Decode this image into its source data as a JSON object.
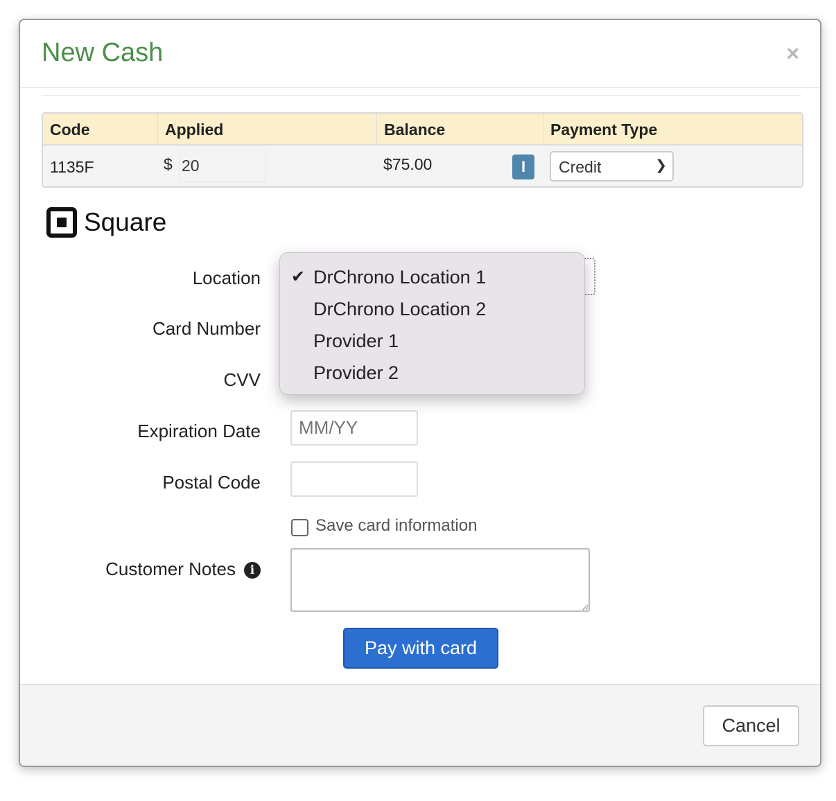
{
  "modal": {
    "title": "New Cash",
    "close_label": "×"
  },
  "table": {
    "headers": [
      "Code",
      "Applied",
      "Balance",
      "Payment Type"
    ],
    "row": {
      "code": "1135F",
      "currency": "$",
      "applied": "20",
      "balance": "$75.00",
      "info_button": "I",
      "payment_type": "Credit"
    }
  },
  "brand": {
    "name": "Square"
  },
  "form": {
    "location_label": "Location",
    "location_options": [
      "DrChrono Location 1",
      "DrChrono Location 2",
      "Provider 1",
      "Provider 2"
    ],
    "location_selected": "DrChrono Location 1",
    "card_number_label": "Card Number",
    "cvv_label": "CVV",
    "expiration_label": "Expiration Date",
    "expiration_placeholder": "MM/YY",
    "postal_label": "Postal Code",
    "save_card_label": "Save card information",
    "notes_label": "Customer Notes",
    "pay_label": "Pay with card"
  },
  "footer": {
    "cancel_label": "Cancel"
  },
  "colors": {
    "title": "#4a8f4a",
    "table_header": "#fcefcb",
    "pay_button": "#2d6fd0",
    "info_button": "#4f86ab"
  }
}
